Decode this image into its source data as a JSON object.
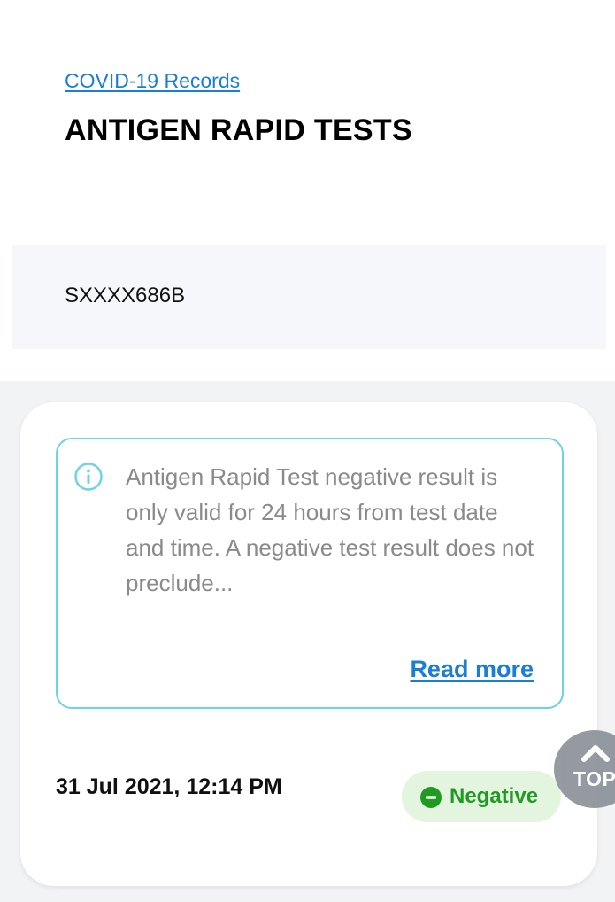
{
  "breadcrumb": {
    "label": "COVID-19 Records"
  },
  "page": {
    "title": "ANTIGEN RAPID TESTS"
  },
  "identity": {
    "masked_id": "SXXXX686B"
  },
  "record": {
    "notice": {
      "icon": "info-circle-icon",
      "text": "Antigen Rapid Test negative result is only valid for 24 hours from test date and time. A negative test result does not preclude...",
      "read_more_label": "Read more"
    },
    "test_datetime": "31 Jul 2021, 12:14 PM",
    "result": {
      "label": "Negative",
      "icon": "minus-circle-icon",
      "color": "#1f9a22",
      "background": "#e4f5df"
    }
  },
  "scroll_top": {
    "label": "TOP",
    "icon": "chevron-up-icon"
  },
  "colors": {
    "link": "#1a7fd4",
    "notice_border": "#6dd3e6",
    "panel_background": "#f6f7fb"
  }
}
